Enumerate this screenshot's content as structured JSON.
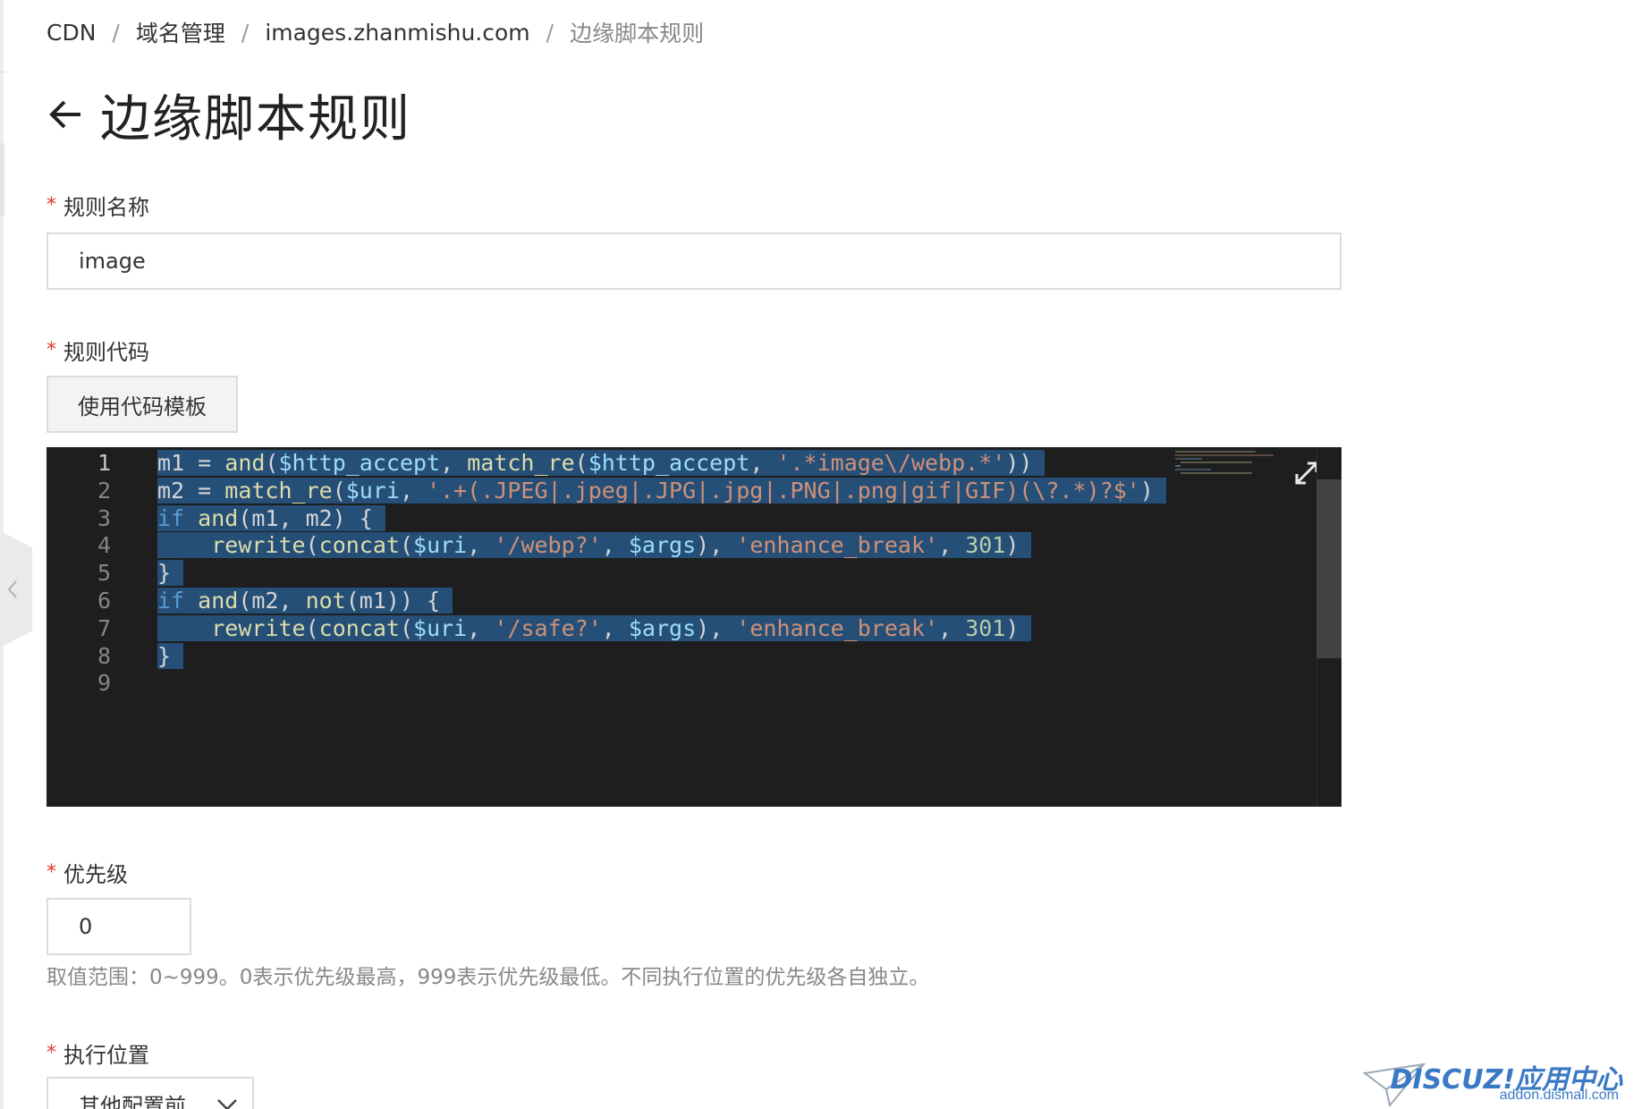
{
  "breadcrumb": {
    "items": [
      "CDN",
      "域名管理",
      "images.zhanmishu.com"
    ],
    "current": "边缘脚本规则",
    "separator": "/"
  },
  "page_title": "边缘脚本规则",
  "form": {
    "rule_name": {
      "label": "规则名称",
      "value": "image"
    },
    "rule_code": {
      "label": "规则代码",
      "template_button": "使用代码模板"
    },
    "priority": {
      "label": "优先级",
      "value": "0",
      "hint": "取值范围：0~999。0表示优先级最高，999表示优先级最低。不同执行位置的优先级各自独立。"
    },
    "exec_position": {
      "label": "执行位置",
      "selected": "其他配置前"
    }
  },
  "code_editor": {
    "line_numbers": [
      "1",
      "2",
      "3",
      "4",
      "5",
      "6",
      "7",
      "8",
      "9"
    ],
    "lines": [
      [
        [
          "plain",
          "m1 = "
        ],
        [
          "fn",
          "and"
        ],
        [
          "plain",
          "("
        ],
        [
          "var",
          "$http_accept"
        ],
        [
          "plain",
          ", "
        ],
        [
          "fn",
          "match_re"
        ],
        [
          "plain",
          "("
        ],
        [
          "var",
          "$http_accept"
        ],
        [
          "plain",
          ", "
        ],
        [
          "str",
          "'.*image\\/webp.*'"
        ],
        [
          "plain",
          "))"
        ]
      ],
      [
        [
          "plain",
          "m2 = "
        ],
        [
          "fn",
          "match_re"
        ],
        [
          "plain",
          "("
        ],
        [
          "var",
          "$uri"
        ],
        [
          "plain",
          ", "
        ],
        [
          "str",
          "'.+(.JPEG|.jpeg|.JPG|.jpg|.PNG|.png|gif|GIF)(\\?.*)?$'"
        ],
        [
          "plain",
          ")"
        ]
      ],
      [
        [
          "kw",
          "if "
        ],
        [
          "fn",
          "and"
        ],
        [
          "plain",
          "(m1, m2) {"
        ]
      ],
      [
        [
          "plain",
          "    "
        ],
        [
          "fn",
          "rewrite"
        ],
        [
          "plain",
          "("
        ],
        [
          "fn",
          "concat"
        ],
        [
          "plain",
          "("
        ],
        [
          "var",
          "$uri"
        ],
        [
          "plain",
          ", "
        ],
        [
          "str",
          "'/webp?'"
        ],
        [
          "plain",
          ", "
        ],
        [
          "var",
          "$args"
        ],
        [
          "plain",
          "), "
        ],
        [
          "str",
          "'enhance_break'"
        ],
        [
          "plain",
          ", "
        ],
        [
          "num",
          "301"
        ],
        [
          "plain",
          ")"
        ]
      ],
      [
        [
          "plain",
          "}"
        ]
      ],
      [
        [
          "kw",
          "if "
        ],
        [
          "fn",
          "and"
        ],
        [
          "plain",
          "(m2, "
        ],
        [
          "fn",
          "not"
        ],
        [
          "plain",
          "(m1)) {"
        ]
      ],
      [
        [
          "plain",
          "    "
        ],
        [
          "fn",
          "rewrite"
        ],
        [
          "plain",
          "("
        ],
        [
          "fn",
          "concat"
        ],
        [
          "plain",
          "("
        ],
        [
          "var",
          "$uri"
        ],
        [
          "plain",
          ", "
        ],
        [
          "str",
          "'/safe?'"
        ],
        [
          "plain",
          ", "
        ],
        [
          "var",
          "$args"
        ],
        [
          "plain",
          "), "
        ],
        [
          "str",
          "'enhance_break'"
        ],
        [
          "plain",
          ", "
        ],
        [
          "num",
          "301"
        ],
        [
          "plain",
          ")"
        ]
      ],
      [
        [
          "plain",
          "}"
        ]
      ],
      []
    ],
    "active_line": 1
  },
  "icons": {
    "back": "arrow-left-icon",
    "expand": "expand-icon",
    "collapse": "chevron-left-icon",
    "select": "chevron-down-icon"
  },
  "colors": {
    "required": "#e03b2c",
    "editor_bg": "#1e1e1e",
    "selection": "#264f78"
  },
  "watermark": {
    "logo": "DISCUZ!应用中心",
    "sub": "addon.dismall.com"
  }
}
